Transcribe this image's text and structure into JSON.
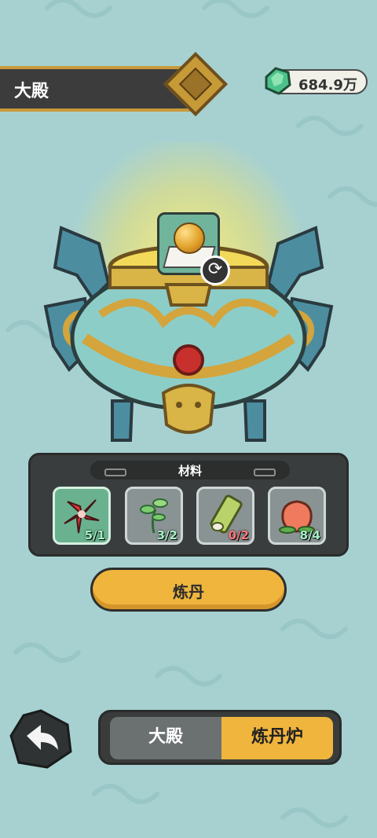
{
  "header": {
    "title": "大殿"
  },
  "currency": {
    "value": "684.9万",
    "icon": "jade-gem-icon"
  },
  "furnace": {
    "selected_item_icon": "golden-pill-icon",
    "refresh_icon": "refresh-icon",
    "refresh_symbol": "⟳"
  },
  "materials": {
    "title": "材料",
    "items": [
      {
        "icon": "red-flower-icon",
        "count": "5/1",
        "enough": true
      },
      {
        "icon": "herb-sprout-icon",
        "count": "3/2",
        "enough": true
      },
      {
        "icon": "bamboo-tube-icon",
        "count": "0/2",
        "enough": false
      },
      {
        "icon": "peach-icon",
        "count": "8/4",
        "enough": true
      }
    ]
  },
  "craft": {
    "label": "炼丹"
  },
  "nav": {
    "back_icon": "back-arrow-icon",
    "tabs": [
      {
        "label": "大殿",
        "active": false
      },
      {
        "label": "炼丹炉",
        "active": true
      }
    ]
  },
  "colors": {
    "background": "#a7d1d1",
    "accent": "#f0b53d",
    "panel": "#3a3d3d"
  }
}
